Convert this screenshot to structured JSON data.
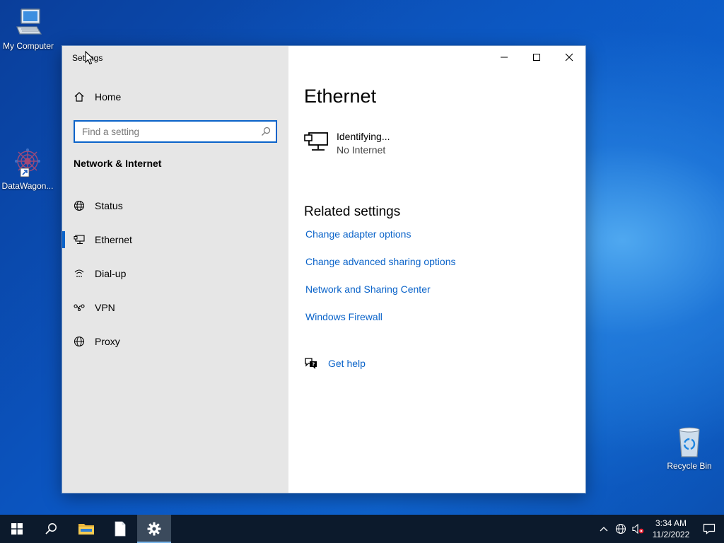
{
  "desktop": {
    "icons": [
      {
        "label": "My Computer"
      },
      {
        "label": "DataWagon..."
      },
      {
        "label": "Recycle Bin"
      }
    ]
  },
  "window": {
    "title": "Settings",
    "sidebar": {
      "home_label": "Home",
      "search_placeholder": "Find a setting",
      "section_title": "Network & Internet",
      "items": [
        {
          "label": "Status",
          "icon": "status-globe-icon"
        },
        {
          "label": "Ethernet",
          "icon": "ethernet-icon",
          "active": true
        },
        {
          "label": "Dial-up",
          "icon": "dialup-icon"
        },
        {
          "label": "VPN",
          "icon": "vpn-icon"
        },
        {
          "label": "Proxy",
          "icon": "proxy-globe-icon"
        }
      ]
    },
    "main": {
      "title": "Ethernet",
      "connection": {
        "name": "Identifying...",
        "status": "No Internet"
      },
      "related_title": "Related settings",
      "links": [
        "Change adapter options",
        "Change advanced sharing options",
        "Network and Sharing Center",
        "Windows Firewall"
      ],
      "help_label": "Get help"
    }
  },
  "taskbar": {
    "clock": {
      "time": "3:34 AM",
      "date": "11/2/2022"
    }
  },
  "colors": {
    "accent": "#0a63c9",
    "sidebar_bg": "#e6e6e6",
    "taskbar_bg": "#0c1a2c"
  }
}
